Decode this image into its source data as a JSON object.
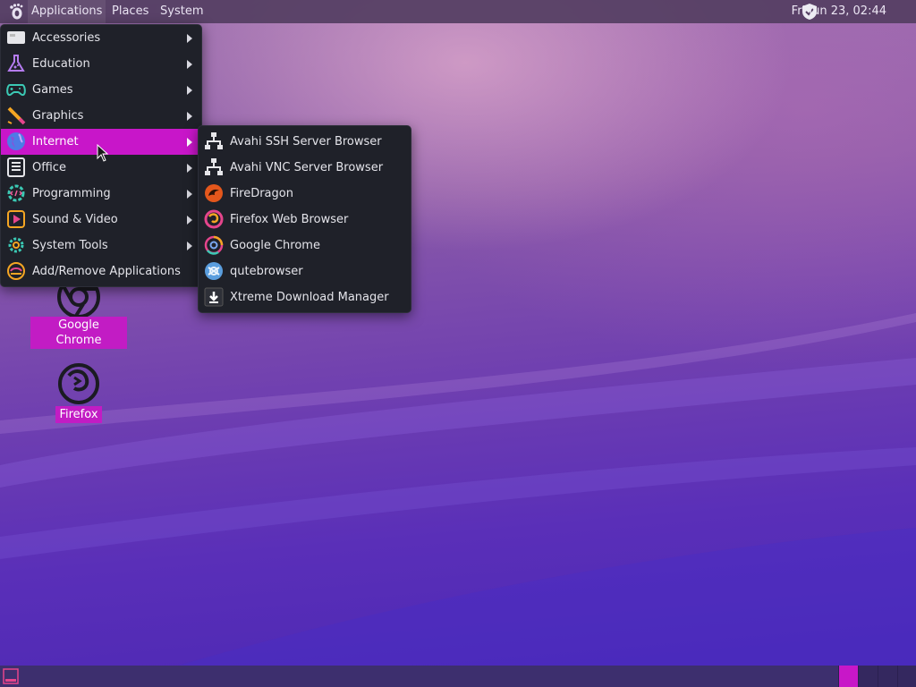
{
  "top_panel": {
    "applications": "Applications",
    "places": "Places",
    "system": "System",
    "clock": "Fri Jun 23, 02:44"
  },
  "main_menu": {
    "items": [
      {
        "label": "Accessories",
        "icon": "accessories-icon",
        "submenu": true
      },
      {
        "label": "Education",
        "icon": "education-icon",
        "submenu": true
      },
      {
        "label": "Games",
        "icon": "games-icon",
        "submenu": true
      },
      {
        "label": "Graphics",
        "icon": "graphics-icon",
        "submenu": true
      },
      {
        "label": "Internet",
        "icon": "internet-icon",
        "submenu": true,
        "highlighted": true
      },
      {
        "label": "Office",
        "icon": "office-icon",
        "submenu": true
      },
      {
        "label": "Programming",
        "icon": "programming-icon",
        "submenu": true
      },
      {
        "label": "Sound & Video",
        "icon": "sound-video-icon",
        "submenu": true
      },
      {
        "label": "System Tools",
        "icon": "system-tools-icon",
        "submenu": true
      },
      {
        "label": "Add/Remove Applications",
        "icon": "add-remove-icon",
        "submenu": false
      }
    ]
  },
  "internet_submenu": {
    "items": [
      {
        "label": "Avahi SSH Server Browser",
        "icon": "network-icon"
      },
      {
        "label": "Avahi VNC Server Browser",
        "icon": "network-icon"
      },
      {
        "label": "FireDragon",
        "icon": "firedragon-icon"
      },
      {
        "label": "Firefox Web Browser",
        "icon": "firefox-icon"
      },
      {
        "label": "Google Chrome",
        "icon": "chrome-icon"
      },
      {
        "label": "qutebrowser",
        "icon": "qutebrowser-icon"
      },
      {
        "label": "Xtreme Download Manager",
        "icon": "download-icon"
      }
    ]
  },
  "desktop_icons": [
    {
      "label": "Google Chrome",
      "icon": "chrome-icon"
    },
    {
      "label": "Firefox",
      "icon": "firefox-icon"
    }
  ],
  "colors": {
    "accent": "#c816c9",
    "menu_bg": "#1f2129",
    "panel_bg": "#543e62",
    "bottom_panel_bg": "#3d2f6e"
  }
}
